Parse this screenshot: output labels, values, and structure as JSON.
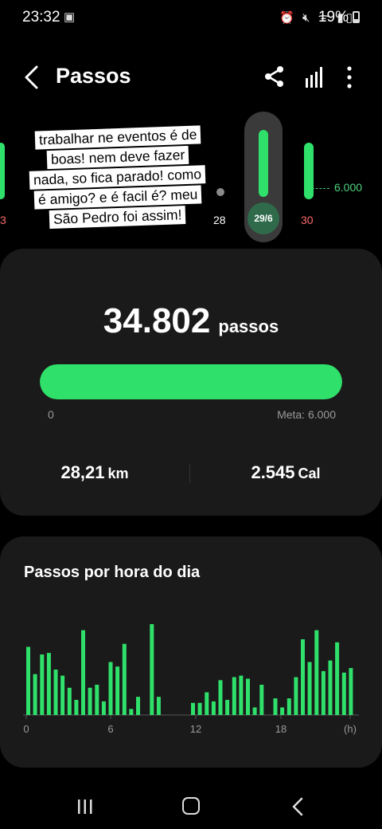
{
  "status": {
    "time": "23:32",
    "battery": "19%",
    "icons": [
      "cast-icon",
      "alarm-icon",
      "mute-icon",
      "wifi-icon",
      "volte-icon",
      "signal-icon",
      "battery-icon"
    ]
  },
  "header": {
    "title": "Passos",
    "actions": [
      "share-icon",
      "stats-icon",
      "more-icon"
    ]
  },
  "week": {
    "labels": {
      "left": "3",
      "d28": "28",
      "selected": "29/6",
      "d30": "30"
    },
    "goal_label": "6.000",
    "bar_levels": {
      "left": 0.85,
      "d28": 0.05,
      "d29": 1.0,
      "d30": 0.85
    },
    "accent_color": "#2fe06a",
    "weekend_color": "#ff6b6b"
  },
  "caption": {
    "lines": [
      "trabalhar ne eventos é de",
      "boas! nem deve fazer",
      "nada, so fica parado! como",
      "é amigo? e é facil é? meu",
      "São Pedro foi assim!"
    ]
  },
  "summary": {
    "steps": "34.802",
    "steps_unit": "passos",
    "progress_min": "0",
    "progress_goal": "Meta: 6.000",
    "progress_fraction": 1.0,
    "distance_value": "28,21",
    "distance_unit": "km",
    "calories_value": "2.545",
    "calories_unit": "Cal"
  },
  "hourly": {
    "title": "Passos por hora do dia"
  },
  "chart_data": {
    "type": "bar",
    "title": "Passos por hora do dia",
    "xlabel": "(h)",
    "ylabel": "",
    "x_ticks": [
      "0",
      "6",
      "12",
      "18",
      "(h)"
    ],
    "x_range": [
      0,
      24
    ],
    "bars_per_hour": 2,
    "values": [
      90,
      54,
      80,
      82,
      60,
      52,
      36,
      20,
      112,
      36,
      40,
      18,
      70,
      64,
      94,
      8,
      24,
      0,
      120,
      24,
      0,
      0,
      0,
      0,
      16,
      16,
      30,
      18,
      46,
      20,
      50,
      52,
      48,
      10,
      40,
      0,
      22,
      10,
      22,
      50,
      100,
      70,
      112,
      58,
      72,
      96,
      56,
      62
    ]
  },
  "nav": {
    "icons": [
      "recent-apps-icon",
      "home-icon",
      "back-icon"
    ]
  }
}
